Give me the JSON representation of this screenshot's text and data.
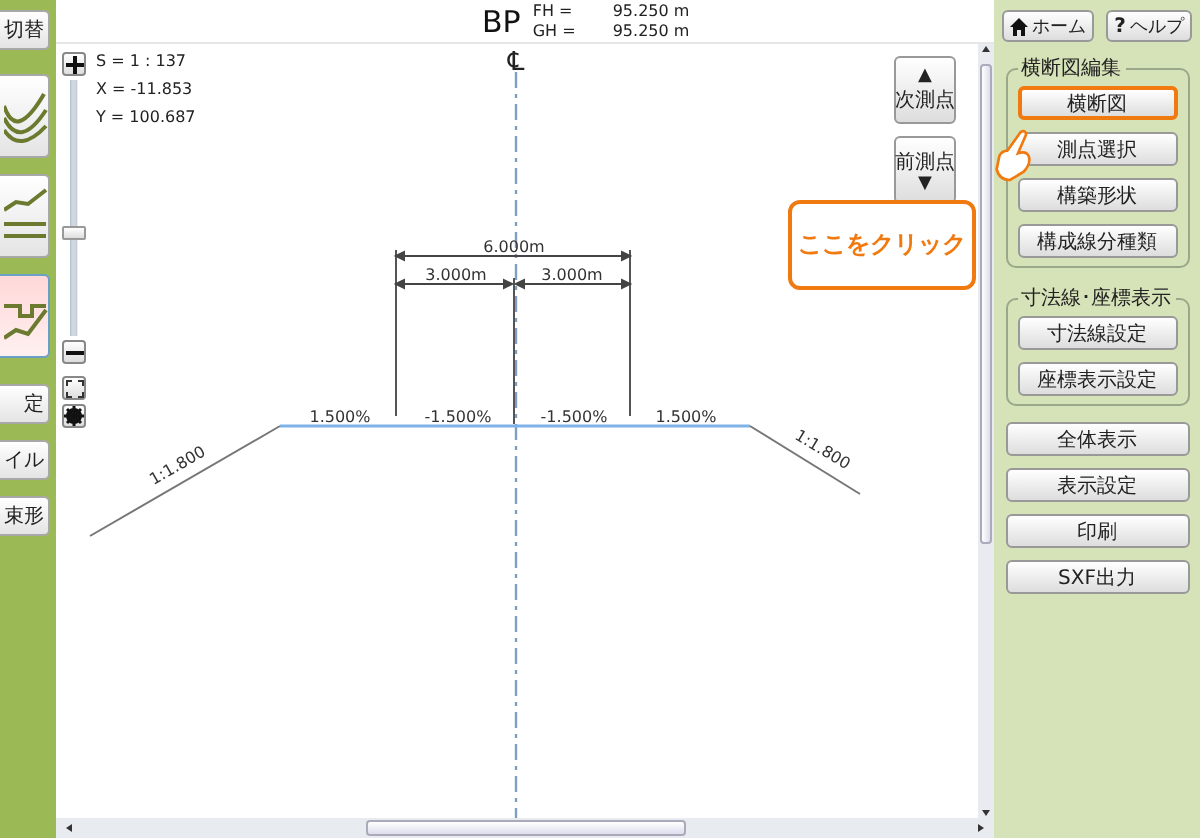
{
  "left_toolbar": [
    {
      "kind": "text",
      "label": "切替",
      "selected": false
    },
    {
      "kind": "curves",
      "selected": false
    },
    {
      "kind": "profile",
      "selected": false
    },
    {
      "kind": "section",
      "selected": true
    },
    {
      "kind": "text",
      "label": "定",
      "selected": false
    },
    {
      "kind": "text",
      "label": "イル",
      "selected": false
    },
    {
      "kind": "text",
      "label": "束形",
      "selected": false
    }
  ],
  "header": {
    "station": "BP",
    "readings": [
      {
        "label": "FH =",
        "value": "95.250 m"
      },
      {
        "label": "GH =",
        "value": "95.250 m"
      }
    ]
  },
  "canvas": {
    "coords": [
      "S = 1 : 137",
      "X = -11.853",
      "Y = 100.687"
    ],
    "zoom": {
      "level": 0.4
    },
    "nav_buttons": [
      {
        "kind": "up",
        "label": "次測点",
        "arrow": "▲"
      },
      {
        "kind": "down",
        "label": "前測点",
        "arrow": "▼"
      }
    ],
    "drawing": {
      "centerline_mark": "℄",
      "dimensions": {
        "total": "6.000m",
        "left": "3.000m",
        "right": "3.000m"
      },
      "slopes": [
        "1.500%",
        "-1.500%",
        "-1.500%",
        "1.500%"
      ],
      "side_slopes": [
        "1:1.800",
        "1:1.800"
      ]
    }
  },
  "callout": {
    "text": "ここをクリック"
  },
  "right_panel": {
    "top_buttons": [
      {
        "kind": "home",
        "label": "ホーム"
      },
      {
        "kind": "help",
        "icon": "?",
        "label": "ヘルプ"
      }
    ],
    "groups": [
      {
        "title": "横断図編集",
        "buttons": [
          {
            "label": "横断図",
            "selected": true
          },
          {
            "label": "測点選択",
            "selected": false
          },
          {
            "label": "構築形状",
            "selected": false
          },
          {
            "label": "構成線分種類",
            "selected": false
          }
        ]
      },
      {
        "title": "寸法線･座標表示",
        "buttons": [
          {
            "label": "寸法線設定",
            "selected": false
          },
          {
            "label": "座標表示設定",
            "selected": false
          }
        ]
      }
    ],
    "buttons": [
      "全体表示",
      "表示設定",
      "印刷",
      "SXF出力"
    ]
  }
}
